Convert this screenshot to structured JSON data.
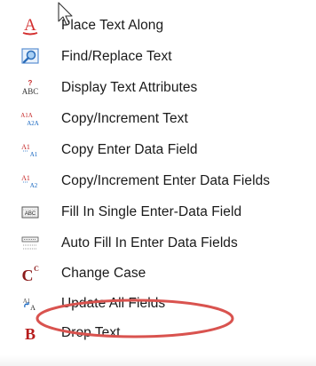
{
  "menu": {
    "items": [
      {
        "label": "Place Text Along",
        "icon": "place-text-along-icon"
      },
      {
        "label": "Find/Replace Text",
        "icon": "find-replace-icon"
      },
      {
        "label": "Display Text Attributes",
        "icon": "text-attributes-icon"
      },
      {
        "label": "Copy/Increment Text",
        "icon": "copy-increment-text-icon"
      },
      {
        "label": "Copy Enter Data Field",
        "icon": "copy-enter-data-field-icon"
      },
      {
        "label": "Copy/Increment Enter Data Fields",
        "icon": "copy-increment-data-fields-icon"
      },
      {
        "label": "Fill In Single Enter-Data Field",
        "icon": "fill-single-field-icon"
      },
      {
        "label": "Auto Fill In Enter Data Fields",
        "icon": "auto-fill-fields-icon"
      },
      {
        "label": "Change Case",
        "icon": "change-case-icon"
      },
      {
        "label": "Update All Fields",
        "icon": "update-fields-icon",
        "highlighted": true
      },
      {
        "label": "Drop Text",
        "icon": "drop-text-icon"
      }
    ]
  },
  "colors": {
    "highlight_ellipse": "#d9534f",
    "place_text_icon": "#d32f2f",
    "change_case_icon": "#8b1a1a",
    "drop_text_icon": "#b71c1c",
    "blue_icon": "#1565c0"
  }
}
